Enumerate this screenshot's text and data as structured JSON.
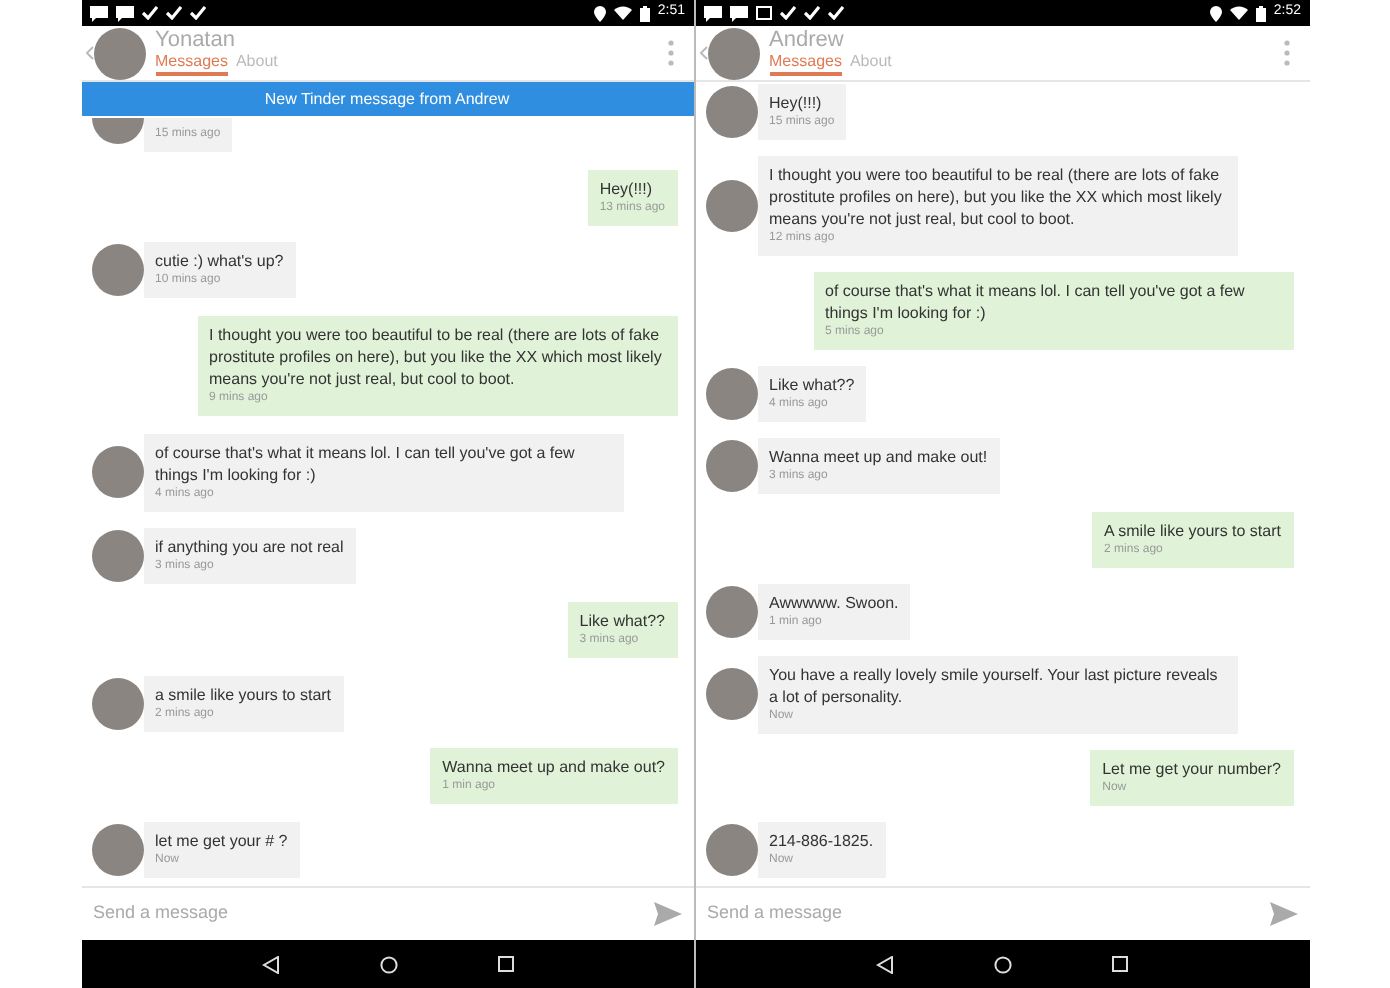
{
  "screens": [
    {
      "status_bar": {
        "time": "2:51",
        "notifications": [
          {
            "kind": "message"
          },
          {
            "kind": "message"
          },
          {
            "kind": "check"
          },
          {
            "kind": "check"
          },
          {
            "kind": "check"
          }
        ]
      },
      "contact": {
        "name": "Yonatan"
      },
      "tabs": [
        {
          "label": "Messages",
          "selected": true
        },
        {
          "label": "About",
          "selected": false
        }
      ],
      "banner": "New Tinder message from Andrew",
      "messages": [
        {
          "kind": "incoming",
          "time": "15 mins ago"
        },
        {
          "kind": "outgoing",
          "text": "Hey(!!!)",
          "time": "13 mins ago"
        },
        {
          "kind": "incoming",
          "text": "cutie :) what's up?",
          "time": "10 mins ago"
        },
        {
          "kind": "outgoing",
          "text": "I thought you were too beautiful to be real (there are lots of fake prostitute profiles on here), but you like the XX which most likely means you're not just real, but cool to boot.",
          "time": "9 mins ago"
        },
        {
          "kind": "incoming",
          "text": "of course that's what it means lol. I can tell you've got a few things I'm looking for :)",
          "time": "4 mins ago"
        },
        {
          "kind": "incoming",
          "text": "if anything you are not real",
          "time": "3 mins ago"
        },
        {
          "kind": "outgoing",
          "text": "Like what??",
          "time": "3 mins ago"
        },
        {
          "kind": "incoming",
          "text": "a smile like yours to start",
          "time": "2 mins ago"
        },
        {
          "kind": "outgoing",
          "text": "Wanna meet up and make out?",
          "time": "1 min ago"
        },
        {
          "kind": "incoming",
          "text": "let me get your # ?",
          "time": "Now"
        }
      ],
      "composer": {
        "placeholder": "Send a message"
      }
    },
    {
      "status_bar": {
        "time": "2:52",
        "notifications": [
          {
            "kind": "message"
          },
          {
            "kind": "message"
          },
          {
            "kind": "image"
          },
          {
            "kind": "check"
          },
          {
            "kind": "check"
          },
          {
            "kind": "check"
          }
        ]
      },
      "contact": {
        "name": "Andrew"
      },
      "tabs": [
        {
          "label": "Messages",
          "selected": true
        },
        {
          "label": "About",
          "selected": false
        }
      ],
      "messages": [
        {
          "kind": "incoming",
          "text": "Hey(!!!)",
          "time": "15 mins ago"
        },
        {
          "kind": "incoming",
          "text": "I thought you were too beautiful to be real (there are lots of fake prostitute profiles on here), but you like the XX which most likely means you're not just real, but cool to boot.",
          "time": "12 mins ago"
        },
        {
          "kind": "outgoing",
          "text": "of course that's what it means lol. I can tell you've got a few things I'm looking for :)",
          "time": "5 mins ago"
        },
        {
          "kind": "incoming",
          "text": "Like what??",
          "time": "4 mins ago"
        },
        {
          "kind": "incoming",
          "text": "Wanna meet up and make out!",
          "time": "3 mins ago"
        },
        {
          "kind": "outgoing",
          "text": "A smile like yours to start",
          "time": "2 mins ago"
        },
        {
          "kind": "incoming",
          "text": "Awwwww. Swoon.",
          "time": "1 min ago"
        },
        {
          "kind": "incoming",
          "text": "You have a really lovely smile yourself. Your last picture reveals a lot of personality.",
          "time": "Now"
        },
        {
          "kind": "outgoing",
          "text": "Let me get your number?",
          "time": "Now"
        },
        {
          "kind": "incoming",
          "text": "214-886-1825.",
          "time": "Now"
        }
      ],
      "composer": {
        "placeholder": "Send a message"
      }
    }
  ]
}
